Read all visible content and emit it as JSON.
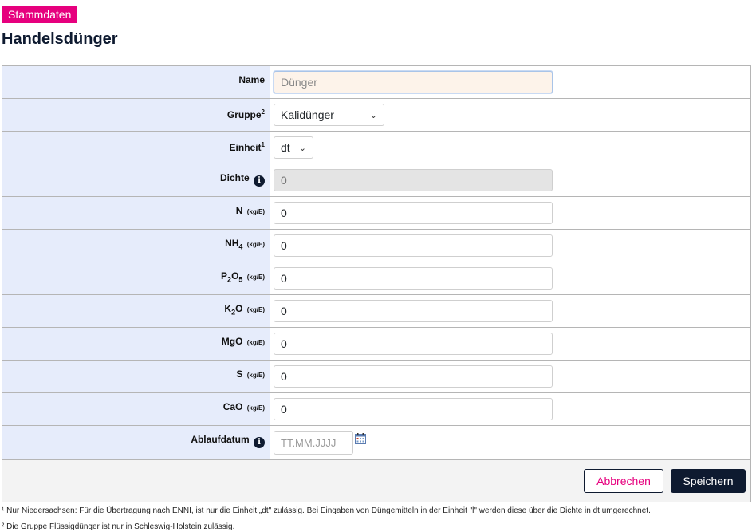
{
  "header": {
    "badge": "Stammdaten",
    "title": "Handelsdünger"
  },
  "form": {
    "name": {
      "label": "Name",
      "placeholder": "Dünger",
      "value": ""
    },
    "gruppe": {
      "label": "Gruppe",
      "marker": "2",
      "value": "Kalidünger"
    },
    "einheit": {
      "label": "Einheit",
      "marker": "1",
      "value": "dt"
    },
    "dichte": {
      "label": "Dichte",
      "value": "0"
    },
    "n": {
      "label": "N",
      "unit": "(kg/E)",
      "value": "0"
    },
    "nh4": {
      "label": "NH",
      "sub": "4",
      "unit": "(kg/E)",
      "value": "0"
    },
    "p2o5": {
      "label_a": "P",
      "sub_a": "2",
      "label_b": "O",
      "sub_b": "5",
      "unit": "(kg/E)",
      "value": "0"
    },
    "k2o": {
      "label_a": "K",
      "sub_a": "2",
      "label_b": "O",
      "unit": "(kg/E)",
      "value": "0"
    },
    "mgo": {
      "label": "MgO",
      "unit": "(kg/E)",
      "value": "0"
    },
    "s": {
      "label": "S",
      "unit": "(kg/E)",
      "value": "0"
    },
    "cao": {
      "label": "CaO",
      "unit": "(kg/E)",
      "value": "0"
    },
    "ablaufdatum": {
      "label": "Ablaufdatum",
      "placeholder": "TT.MM.JJJJ"
    }
  },
  "buttons": {
    "cancel": "Abbrechen",
    "save": "Speichern"
  },
  "footnotes": {
    "one": "¹ Nur Niedersachsen: Für die Übertragung nach ENNI, ist nur die Einheit „dt\" zulässig. Bei Eingaben von Düngemitteln in der Einheit \"l\" werden diese über die Dichte in dt umgerechnet.",
    "two": "² Die Gruppe Flüssigdünger ist nur in Schleswig-Holstein zulässig."
  },
  "icons": {
    "info": "info-icon",
    "calendar": "calendar-icon",
    "dropdown": "chevron-down-icon"
  },
  "colors": {
    "accent": "#e6007e",
    "navy": "#0e1a30",
    "label_bg": "#e6ecfb"
  }
}
